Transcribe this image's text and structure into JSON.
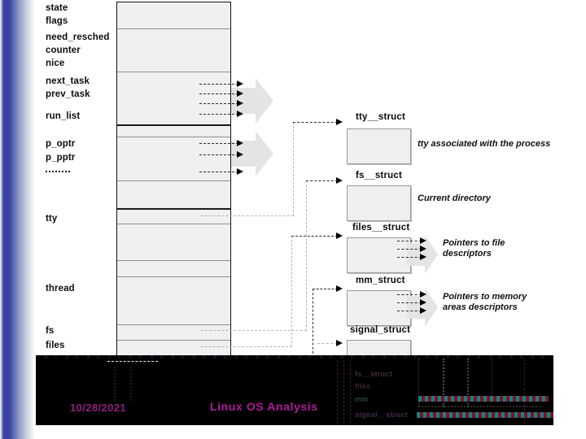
{
  "slide": {
    "diagram_kind": "linux-task-struct-relationships"
  },
  "task_struct": {
    "fields": [
      {
        "label": "state"
      },
      {
        "label": "flags"
      },
      {
        "label": "need_resched"
      },
      {
        "label": "counter"
      },
      {
        "label": "nice"
      },
      {
        "label": "next_task"
      },
      {
        "label": "prev_task"
      },
      {
        "label": "run_list"
      },
      {
        "label": "p_optr"
      },
      {
        "label": "p_pptr"
      },
      {
        "label": "..........."
      },
      {
        "label": "tty"
      },
      {
        "label": "thread"
      },
      {
        "label": "fs"
      },
      {
        "label": "files"
      }
    ]
  },
  "structs": [
    {
      "name": "tty__struct",
      "caption": "tty associated with the process",
      "caption2": ""
    },
    {
      "name": "fs__struct",
      "caption": "Current directory",
      "caption2": ""
    },
    {
      "name": "files__struct",
      "caption": "Pointers to file",
      "caption2": "descriptors"
    },
    {
      "name": "mm_struct",
      "caption": "Pointers to memory",
      "caption2": "areas descriptors"
    },
    {
      "name": "signal_struct",
      "caption": "",
      "caption2": ""
    }
  ],
  "footer": {
    "date": "10/28/2021",
    "title": "Linux OS Analysis"
  },
  "glitch": {
    "lines": [
      "fs__struct",
      "files",
      "mm",
      "signal__struct"
    ]
  },
  "colors": {
    "edge_blue": "#3b41a6",
    "footer_bg": "#000000",
    "footer_magenta": "#b2179f",
    "box_fill": "#efefef",
    "box_border": "#9a9a9a",
    "dash": "#2b2b2b",
    "chevron": "#e2e2e2"
  }
}
